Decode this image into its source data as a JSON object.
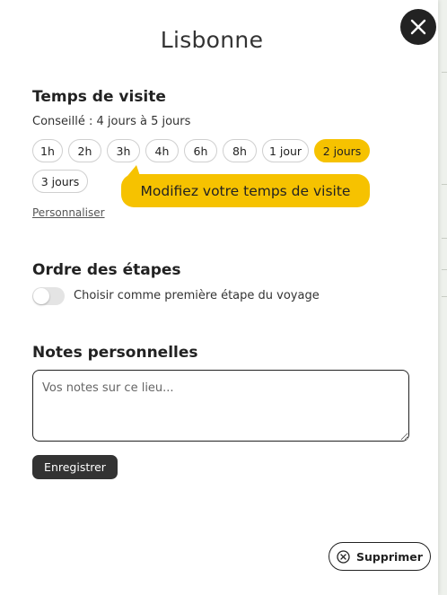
{
  "title": "Lisbonne",
  "visit_time": {
    "heading": "Temps de visite",
    "advice": "Conseillé : 4 jours à 5 jours",
    "options": [
      "1h",
      "2h",
      "3h",
      "4h",
      "6h",
      "8h",
      "1 jour",
      "2 jours",
      "3 jours"
    ],
    "selected": "2 jours",
    "tooltip": "Modifiez votre temps de visite",
    "customize_link": "Personnaliser"
  },
  "order": {
    "heading": "Ordre des étapes",
    "toggle_label": "Choisir comme première étape du voyage",
    "toggle_on": false
  },
  "notes": {
    "heading": "Notes personnelles",
    "placeholder": "Vos notes sur ce lieu...",
    "value": "",
    "save_label": "Enregistrer"
  },
  "delete_label": "Supprimer",
  "colors": {
    "accent": "#f6c200",
    "dark": "#222222"
  },
  "icons": {
    "close": "close-icon",
    "delete": "circle-x-icon"
  }
}
